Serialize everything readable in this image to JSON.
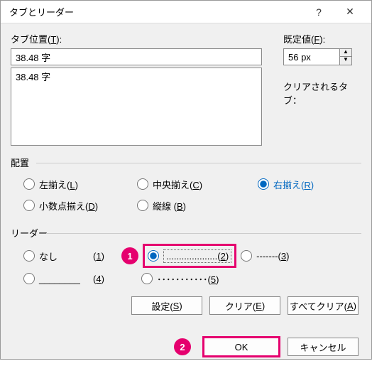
{
  "window": {
    "title": "タブとリーダー"
  },
  "tab_stop": {
    "label_pre": "タブ位置(",
    "label_key": "T",
    "label_post": "):",
    "value": "38.48 字",
    "list": [
      "38.48 字"
    ]
  },
  "default": {
    "label_pre": "既定値(",
    "label_key": "F",
    "label_post": "):",
    "value": "56 px"
  },
  "cleared_label": "クリアされるタブ：",
  "alignment": {
    "group": "配置",
    "left_pre": "左揃え(",
    "left_key": "L",
    "left_post": ")",
    "center_pre": "中央揃え(",
    "center_key": "C",
    "center_post": ")",
    "right_pre": "右揃え(",
    "right_key": "R",
    "right_post": ")",
    "decimal_pre": "小数点揃え(",
    "decimal_key": "D",
    "decimal_post": ")",
    "bar_pre": "縦線 (",
    "bar_key": "B",
    "bar_post": ")"
  },
  "leader": {
    "group": "リーダー",
    "none": "なし",
    "none_num_pre": "(",
    "none_num_key": "1",
    "none_num_post": ")",
    "dots": "....................",
    "dots_num_pre": "(",
    "dots_num_key": "2",
    "dots_num_post": ")",
    "dashes": "-------",
    "dashes_num_pre": "(",
    "dashes_num_key": "3",
    "dashes_num_post": ")",
    "under": "________",
    "under_num_pre": "(",
    "under_num_key": "4",
    "under_num_post": ")",
    "mid": "･･･････････",
    "mid_num_pre": "(",
    "mid_num_key": "5",
    "mid_num_post": ")"
  },
  "buttons": {
    "set_pre": "設定(",
    "set_key": "S",
    "set_post": ")",
    "clear_pre": "クリア(",
    "clear_key": "E",
    "clear_post": ")",
    "clear_all_pre": "すべてクリア(",
    "clear_all_key": "A",
    "clear_all_post": ")",
    "ok": "OK",
    "cancel": "キャンセル"
  },
  "callouts": {
    "one": "1",
    "two": "2"
  }
}
